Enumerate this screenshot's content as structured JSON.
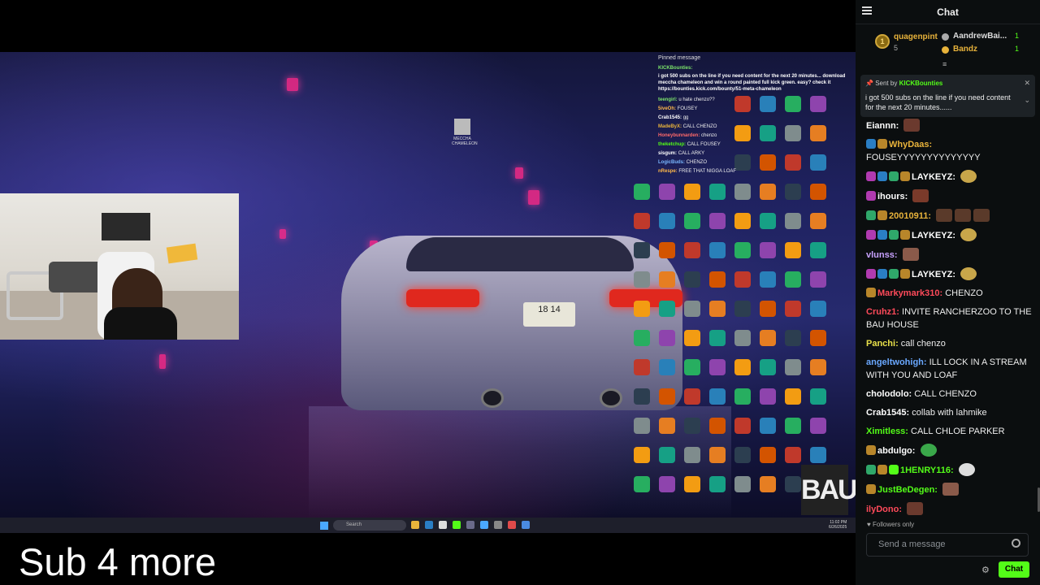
{
  "stream": {
    "pinned_overlay": {
      "title": "Pinned message",
      "name": "KICKBounties:",
      "message": "i got 500 subs on the line if you need content for the next 20 minutes... download meccha chameleon and win a round painted full kick green. easy? check it https://bounties.kick.com/bounty/51-meta-chameleon"
    },
    "overlay_lines": [
      {
        "user": "teengirl:",
        "text": "u hate chenzo??"
      },
      {
        "user": "5iveOh:",
        "text": "FOUSEY"
      },
      {
        "user": "Crab1545:",
        "text": "gg"
      },
      {
        "user": "MadeByX:",
        "text": "CALL CHENZO"
      },
      {
        "user": "Honeybunnarden:",
        "text": "chenzo"
      },
      {
        "user": "theketchup:",
        "text": "CALL FOUSEY"
      },
      {
        "user": "sisgum:",
        "text": "CALL ARKY"
      },
      {
        "user": "LogicBuds:",
        "text": "CHENZO"
      },
      {
        "user": "nRespe:",
        "text": "FREE THAT NIGGA LOAF"
      }
    ],
    "middle_icon_label": "MECCHA CHAMELEON",
    "plate": "18 14",
    "taskbar_search": "Search",
    "clock_time": "11:02 PM",
    "clock_date": "6/26/2025",
    "caption": "Sub 4 more",
    "watermark": "BAU"
  },
  "chat": {
    "title": "Chat",
    "gifters": [
      {
        "name": "quagenpint",
        "count": "5",
        "rank": "1"
      },
      {
        "name": "AandrewBai...",
        "count": "1"
      },
      {
        "name": "Bandz",
        "count": "1"
      }
    ],
    "pinned": {
      "sent_by": "Sent by",
      "name": "KICKBounties",
      "message": "i got 500 subs on the line if you need content for the next 20 minutes......"
    },
    "messages": [
      {
        "user": "Eiannn:",
        "color": "#ffffff",
        "text": "",
        "badges": [],
        "emotes": [
          "#6b3a2e"
        ]
      },
      {
        "user": "WhyDaas:",
        "color": "#e8b33b",
        "text": "FOUSEYYYYYYYYYYYYYY",
        "badges": [
          "#2a7ec4",
          "#b8862a"
        ],
        "emotes": []
      },
      {
        "user": "LAYKEYZ:",
        "color": "#ffffff",
        "text": "",
        "badges": [
          "#b03ab0",
          "#2a7ec4",
          "#2fa86a",
          "#b8862a"
        ],
        "emotes": [
          "#c8a64a"
        ]
      },
      {
        "user": "ihours:",
        "color": "#ffffff",
        "text": "",
        "badges": [
          "#b03ab0"
        ],
        "emotes": [
          "#7a3a2a"
        ]
      },
      {
        "user": "20010911:",
        "color": "#e8b33b",
        "text": "",
        "badges": [
          "#2fa86a",
          "#b8862a"
        ],
        "emotes": [
          "#5a3a2a",
          "#5a3a2a",
          "#5a3a2a"
        ]
      },
      {
        "user": "LAYKEYZ:",
        "color": "#ffffff",
        "text": "",
        "badges": [
          "#b03ab0",
          "#2a7ec4",
          "#2fa86a",
          "#b8862a"
        ],
        "emotes": [
          "#c8a64a"
        ]
      },
      {
        "user": "vlunss:",
        "color": "#c8a2ff",
        "text": "",
        "badges": [],
        "emotes": [
          "#8a5a4a"
        ]
      },
      {
        "user": "LAYKEYZ:",
        "color": "#ffffff",
        "text": "",
        "badges": [
          "#b03ab0",
          "#2a7ec4",
          "#2fa86a",
          "#b8862a"
        ],
        "emotes": [
          "#c8a64a"
        ]
      },
      {
        "user": "Markymark310:",
        "color": "#ff4a5a",
        "text": "CHENZO",
        "badges": [
          "#b8862a"
        ],
        "emotes": []
      },
      {
        "user": "Cruhz1:",
        "color": "#ff4a5a",
        "text": "INVITE RANCHERZOO TO THE BAU HOUSE",
        "badges": [],
        "emotes": []
      },
      {
        "user": "Panchi:",
        "color": "#e8e04a",
        "text": "call chenzo",
        "badges": [],
        "emotes": []
      },
      {
        "user": "angeltwohigh:",
        "color": "#6aa8ff",
        "text": "ILL LOCK IN A STREAM WITH YOU AND LOAF",
        "badges": [],
        "emotes": []
      },
      {
        "user": "cholodolo:",
        "color": "#ffffff",
        "text": "CALL CHENZO",
        "badges": [],
        "emotes": []
      },
      {
        "user": "Crab1545:",
        "color": "#ffffff",
        "text": "collab with lahmike",
        "badges": [],
        "emotes": []
      },
      {
        "user": "Ximitless:",
        "color": "#53fc18",
        "text": "CALL CHLOE PARKER",
        "badges": [],
        "emotes": []
      },
      {
        "user": "abdulgo:",
        "color": "#ffffff",
        "text": "",
        "badges": [
          "#b8862a"
        ],
        "emotes": [
          "#3aa84a"
        ]
      },
      {
        "user": "1HENRY116:",
        "color": "#53fc18",
        "text": "",
        "badges": [
          "#2fa86a",
          "#b8862a",
          "#53fc18"
        ],
        "emotes": [
          "#dddddd"
        ]
      },
      {
        "user": "JustBeDegen:",
        "color": "#53fc18",
        "text": "",
        "badges": [
          "#b8862a"
        ],
        "emotes": [
          "#8a5a4a"
        ]
      },
      {
        "user": "ilyDono:",
        "color": "#ff4a5a",
        "text": "",
        "badges": [],
        "emotes": [
          "#6b3a2e"
        ]
      }
    ],
    "followers_only": "Followers only",
    "input_placeholder": "Send a message",
    "send_label": "Chat"
  }
}
